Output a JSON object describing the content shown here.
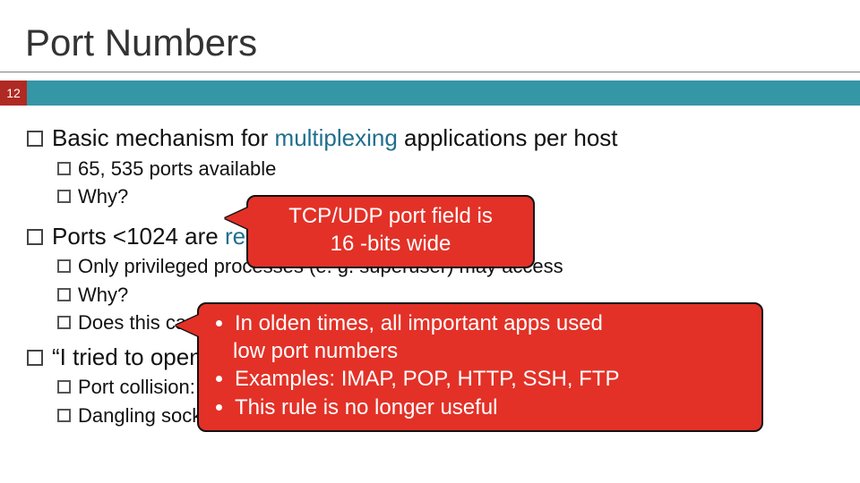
{
  "slide": {
    "title": "Port Numbers",
    "page_number": "12",
    "bullets": {
      "b1": {
        "prefix": "Basic mechanism for ",
        "keyword": "multiplexing",
        "suffix": " applications per host"
      },
      "b1a": "65, 535 ports available",
      "b1b": "Why?",
      "b2": {
        "prefix": "Ports <1024 are ",
        "keyword_partial": "res"
      },
      "b2a": "Only privileged processes (e. g. superuser) may access",
      "b2b": "Why?",
      "b2c_partial": "Does this cause",
      "b3_partial": "“I tried to open a",
      "b3a_partial": "Port collision: on",
      "b3b": "Dangling sockets…"
    },
    "callout1": {
      "line1": "TCP/UDP port field is",
      "line2": "16 -bits wide"
    },
    "callout2": {
      "item1_prefix": "In olden times, all important apps used",
      "item1_cont": "low port numbers",
      "item2": "Examples: IMAP, POP, HTTP, SSH, FTP",
      "item3": "This rule is no longer useful"
    }
  }
}
